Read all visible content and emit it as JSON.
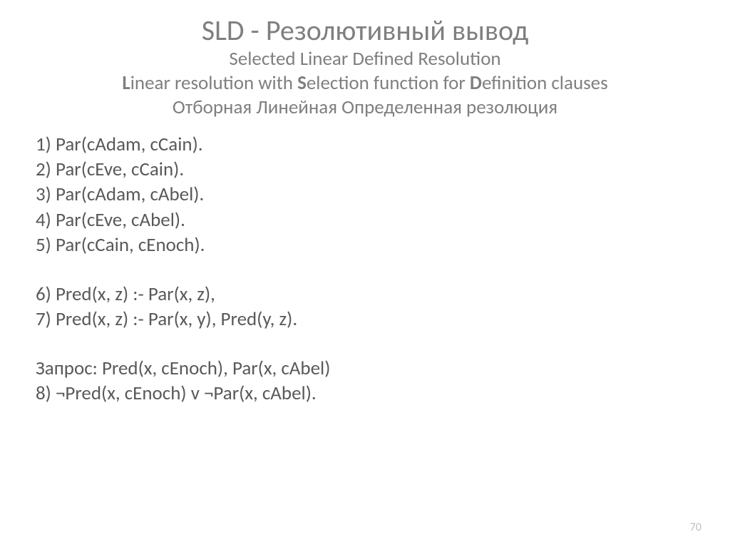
{
  "title": {
    "main": "SLD - Резолютивный вывод",
    "sub1": "Selected Linear Defined Resolution",
    "sub2_pre": "",
    "sub2_L": "L",
    "sub2_a": "inear resolution with ",
    "sub2_S": "S",
    "sub2_b": "election function for ",
    "sub2_D": "D",
    "sub2_c": "efinition clauses",
    "sub3": "Отборная Линейная Определенная резолюция"
  },
  "lines": {
    "l1": "1) Par(cAdam, cCain).",
    "l2": "2) Par(cEve, cCain).",
    "l3": "3) Par(cAdam, cAbel).",
    "l4": "4) Par(cEve, cAbel).",
    "l5": "5) Par(cCain, cEnoch).",
    "l6": "6) Pred(x, z) :-  Par(x, z),",
    "l7": "7) Pred(x, z) :-  Par(x, y), Pred(y, z).",
    "l8": "Запрос: Pred(x, cEnoch), Par(x, cAbel)",
    "l9": "8) ¬Pred(x, cEnoch) v ¬Par(x, cAbel)."
  },
  "page_number": "70"
}
